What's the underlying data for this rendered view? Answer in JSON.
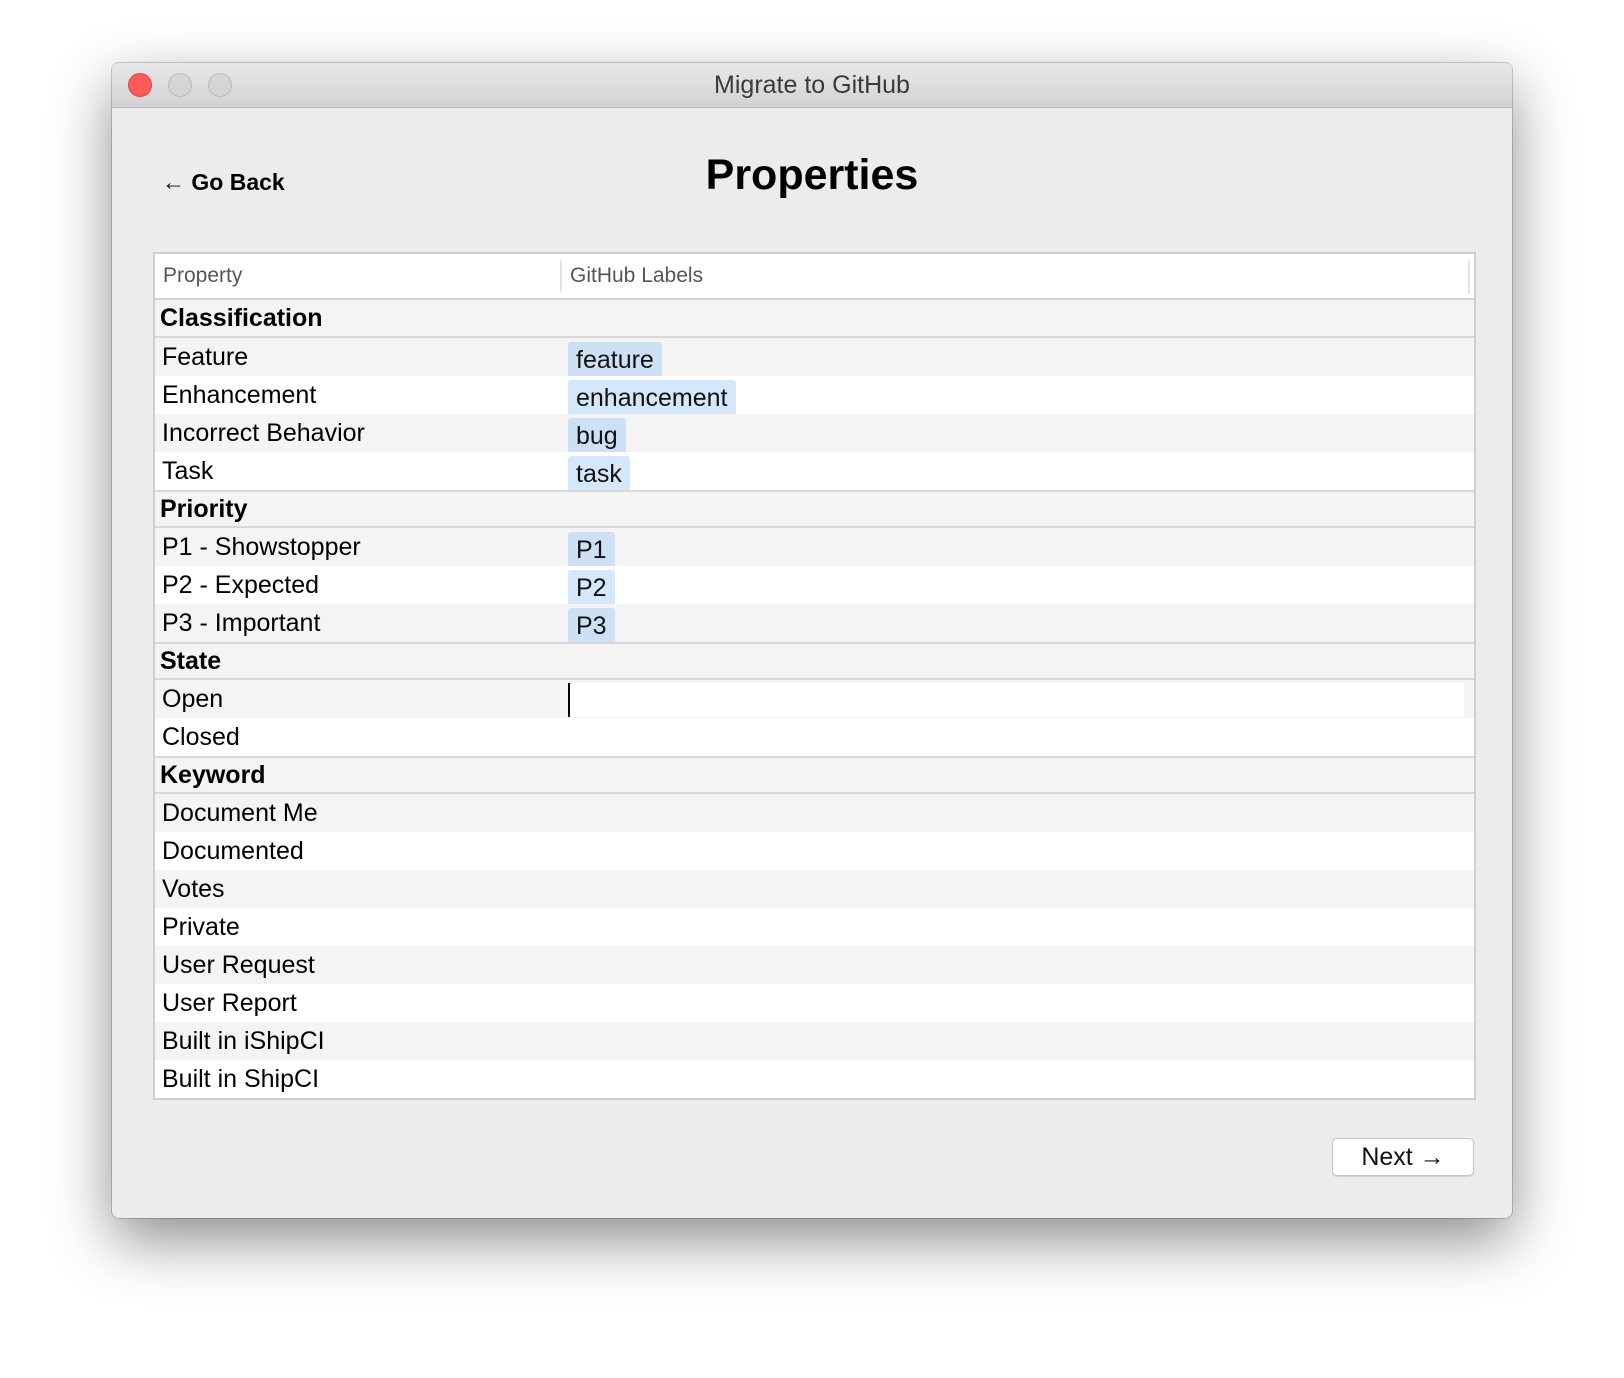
{
  "window": {
    "title": "Migrate to GitHub",
    "controls": {
      "close": "close-button",
      "minimize": "minimize-button",
      "maximize": "zoom-button"
    }
  },
  "nav": {
    "back_label": "← Go Back",
    "page_title": "Properties",
    "next_label": "Next →"
  },
  "table": {
    "columns": [
      "Property",
      "GitHub Labels"
    ],
    "rows": [
      {
        "type": "section",
        "name": "Classification"
      },
      {
        "type": "item",
        "name": "Feature",
        "label": "feature"
      },
      {
        "type": "item",
        "name": "Enhancement",
        "label": "enhancement"
      },
      {
        "type": "item",
        "name": "Incorrect Behavior",
        "label": "bug"
      },
      {
        "type": "item",
        "name": "Task",
        "label": "task"
      },
      {
        "type": "section",
        "name": "Priority"
      },
      {
        "type": "item",
        "name": "P1 - Showstopper",
        "label": "P1"
      },
      {
        "type": "item",
        "name": "P2 - Expected",
        "label": "P2"
      },
      {
        "type": "item",
        "name": "P3 - Important",
        "label": "P3"
      },
      {
        "type": "section",
        "name": "State"
      },
      {
        "type": "item",
        "name": "Open",
        "label": "",
        "editing": true
      },
      {
        "type": "item",
        "name": "Closed",
        "label": ""
      },
      {
        "type": "section",
        "name": "Keyword"
      },
      {
        "type": "item",
        "name": "Document Me",
        "label": ""
      },
      {
        "type": "item",
        "name": "Documented",
        "label": ""
      },
      {
        "type": "item",
        "name": "Votes",
        "label": ""
      },
      {
        "type": "item",
        "name": "Private",
        "label": ""
      },
      {
        "type": "item",
        "name": "User Request",
        "label": ""
      },
      {
        "type": "item",
        "name": "User Report",
        "label": ""
      },
      {
        "type": "item",
        "name": "Built in iShipCI",
        "label": ""
      },
      {
        "type": "item",
        "name": "Built in ShipCI",
        "label": ""
      }
    ]
  },
  "colors": {
    "close": "#fc5b57",
    "label_pill": "#cde0f4",
    "window_bg": "#ececec"
  }
}
